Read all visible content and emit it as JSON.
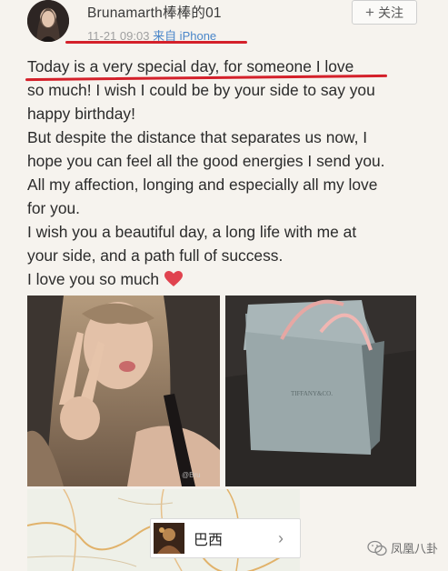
{
  "header": {
    "username": "Brunamarth棒棒的01",
    "time": "11-21 09:03",
    "source": "来自 iPhone",
    "follow_label": "关注",
    "follow_icon": "plus-icon"
  },
  "post": {
    "lines": [
      "Today is a very special day, for someone I love",
      "so much! I wish I could be by your side to say you",
      "happy birthday!",
      "But despite the distance that separates us now, I",
      "hope you can feel all the good energies I send you.",
      "All my affection, longing and especially all my love",
      "for you.",
      "I wish you a beautiful day, a long life with me at",
      "your side, and a path full of success.",
      "I love you so much"
    ],
    "heart_icon": "heart-icon",
    "highlight_color": "#d4202a"
  },
  "photos": {
    "bag_text": "TIFFANY&CO."
  },
  "location": {
    "label": "巴西",
    "chevron": "›"
  },
  "footer": {
    "brand": "凤凰八卦"
  }
}
